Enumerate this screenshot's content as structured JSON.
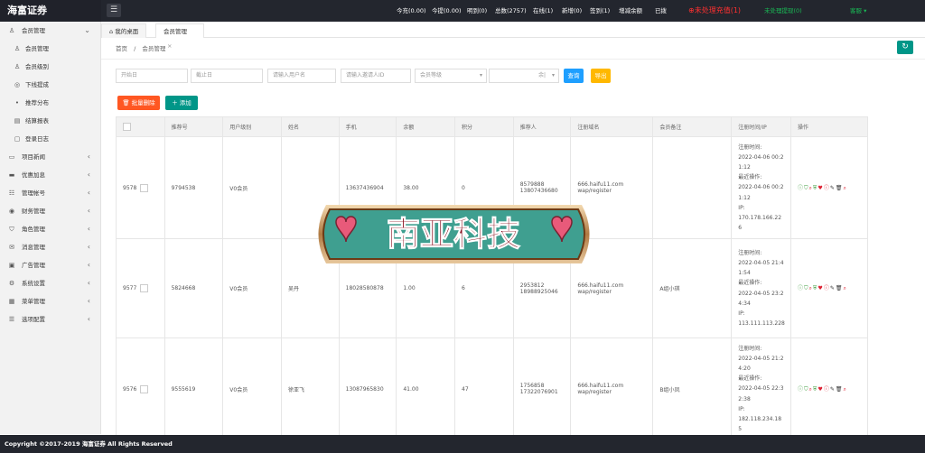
{
  "app": {
    "title": "海富证券"
  },
  "topbar": {
    "menu_icon": "menu-icon",
    "stats": [
      "今充(0.00)",
      "今提(0.00)",
      "明到(0)",
      "总数(2757)",
      "在线(1)",
      "新增(0)",
      "签到(1)",
      "增减余额",
      "已拨"
    ],
    "alert": "未处理充值(1)",
    "pending_withdraw": "未处理提现(0)",
    "user": "客服"
  },
  "sidebar": {
    "items": [
      {
        "label": "会员管理",
        "icon": "user-icon",
        "expanded": true
      },
      {
        "label": "会员管理",
        "icon": "user-icon",
        "sub": true
      },
      {
        "label": "会员级别",
        "icon": "user-icon",
        "sub": true
      },
      {
        "label": "下线提成",
        "icon": "circle-icon",
        "sub": true
      },
      {
        "label": "推荐分布",
        "icon": "dot-icon",
        "sub": true
      },
      {
        "label": "结算报表",
        "icon": "table-icon",
        "sub": true
      },
      {
        "label": "登录日志",
        "icon": "doc-icon",
        "sub": true
      },
      {
        "label": "项目新闻",
        "icon": "news-icon"
      },
      {
        "label": "优惠加息",
        "icon": "card-icon"
      },
      {
        "label": "管理帐号",
        "icon": "account-icon"
      },
      {
        "label": "财务管理",
        "icon": "finance-icon"
      },
      {
        "label": "角色管理",
        "icon": "shield-icon"
      },
      {
        "label": "消息管理",
        "icon": "message-icon"
      },
      {
        "label": "广告管理",
        "icon": "ad-icon"
      },
      {
        "label": "系统设置",
        "icon": "gear-icon"
      },
      {
        "label": "菜单管理",
        "icon": "grid-icon"
      },
      {
        "label": "选项配置",
        "icon": "list-icon"
      }
    ]
  },
  "tabs": {
    "home": "我的桌面",
    "active": "会员管理",
    "close": "×"
  },
  "breadcrumb": {
    "home": "首页",
    "sep": "/",
    "current": "会员管理"
  },
  "filters": {
    "start_date": "开始日",
    "end_date": "截止日",
    "username": "请输入用户名",
    "referrer_id": "请输入邀请人ID",
    "level": "会员等级",
    "extra": "余|"
  },
  "buttons": {
    "search": "查询",
    "export": "导出",
    "batch_delete": "批量删除",
    "add": "添加"
  },
  "table": {
    "columns": [
      "",
      "推荐号",
      "用户级别",
      "姓名",
      "手机",
      "余额",
      "积分",
      "推荐人",
      "注册域名",
      "会员备注",
      "注册时间/IP",
      "操作"
    ],
    "rows": [
      {
        "id": "9578",
        "ref": "9794538",
        "level": "V0会员",
        "name": "",
        "phone": "13637436904",
        "balance": "38.00",
        "points": "0",
        "referrer1": "8579888",
        "referrer2": "13807436680",
        "domain1": "666.haifu11.com",
        "domain2": "wap/register",
        "note": "",
        "reg": [
          "注册时间:",
          "2022-04-06 00:2",
          "1:12",
          "最近操作:",
          "2022-04-06 00:2",
          "1:12",
          "IP:",
          "170.178.166.22",
          "6"
        ]
      },
      {
        "id": "9577",
        "ref": "5824668",
        "level": "V0会员",
        "name": "吴丹",
        "phone": "18028580878",
        "balance": "1.00",
        "points": "6",
        "referrer1": "2953812",
        "referrer2": "18988925046",
        "domain1": "666.haifu11.com",
        "domain2": "wap/register",
        "note": "A组小琪",
        "reg": [
          "注册时间:",
          "2022-04-05 21:4",
          "1:54",
          "最近操作:",
          "2022-04-05 23:2",
          "4:34",
          "IP:",
          "113.111.113.228",
          ""
        ]
      },
      {
        "id": "9576",
        "ref": "9555619",
        "level": "V0会员",
        "name": "徐亚飞",
        "phone": "13087965830",
        "balance": "41.00",
        "points": "47",
        "referrer1": "1756858",
        "referrer2": "17322076901",
        "domain1": "666.haifu11.com",
        "domain2": "wap/register",
        "note": "B组小凤",
        "reg": [
          "注册时间:",
          "2022-04-05 21:2",
          "4:20",
          "最近操作:",
          "2022-04-05 22:3",
          "2:38",
          "IP:",
          "182.118.234.18",
          "5"
        ]
      }
    ]
  },
  "watermark": {
    "text": "南亚科技"
  },
  "footer": {
    "text": "Copyright ©2017-2019 海富证券 All Rights Reserved"
  },
  "colors": {
    "topbar": "#23262e",
    "accent": "#009688",
    "search": "#1e9fff",
    "export": "#ffb800",
    "delete": "#ff5722",
    "alert": "#ff3030"
  }
}
